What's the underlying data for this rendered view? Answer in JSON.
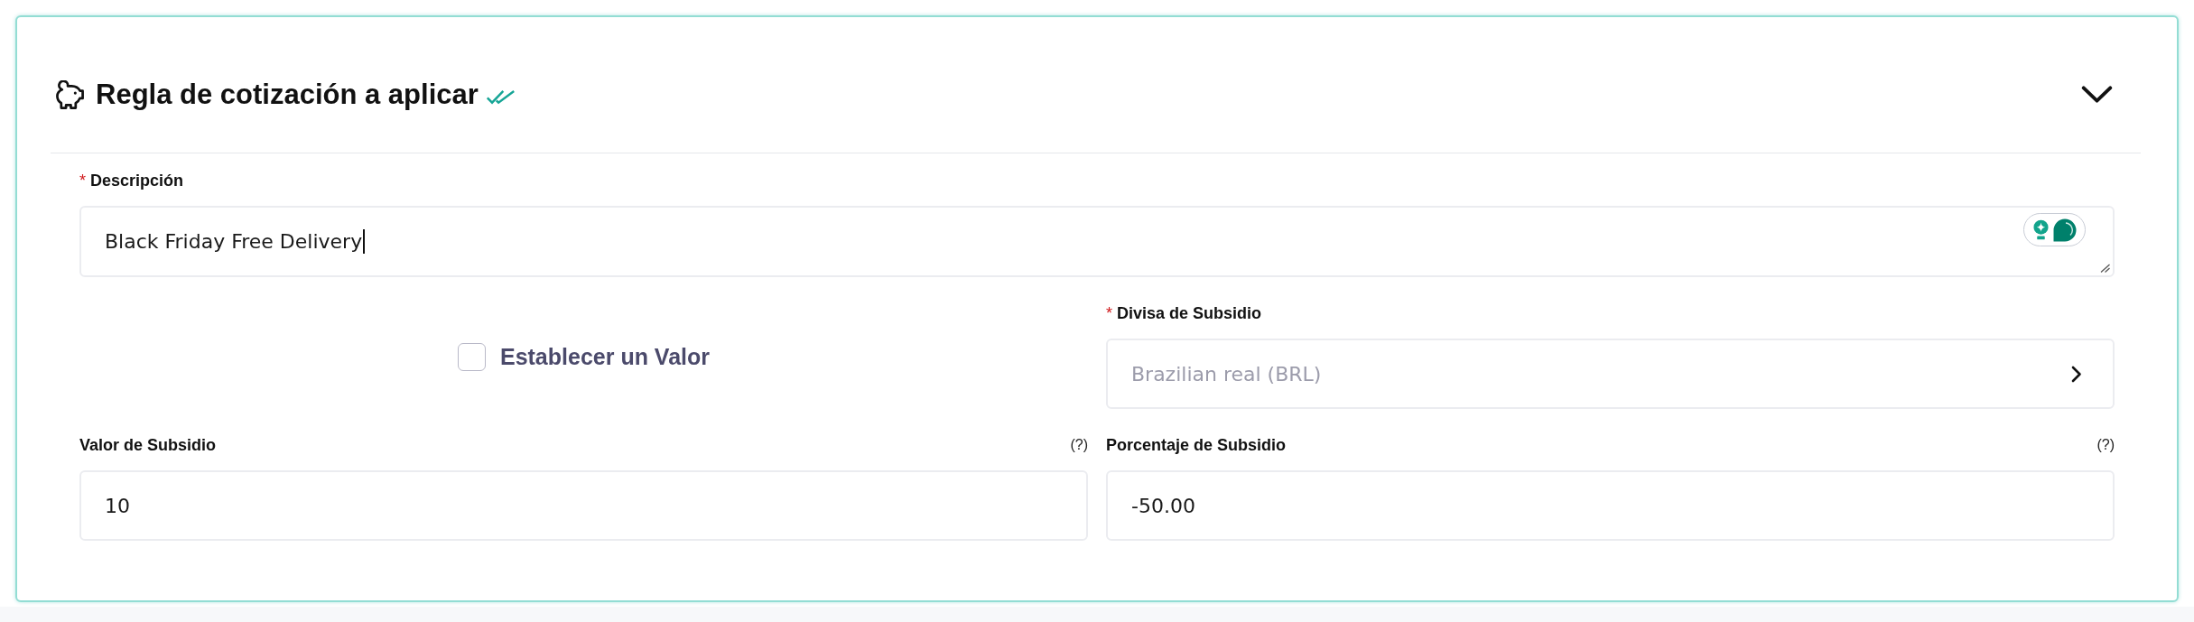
{
  "section": {
    "title": "Regla de cotización a aplicar",
    "verified": true,
    "expanded": true
  },
  "description": {
    "marker": "*",
    "label": "Descripción",
    "value": "Black Friday Free Delivery",
    "focused": true
  },
  "set_value": {
    "label": "Establecer un Valor",
    "checked": false
  },
  "currency": {
    "marker": "*",
    "label": "Divisa de Subsidio",
    "value": "Brazilian real (BRL)",
    "disabled": true
  },
  "amounts": [
    {
      "label": "Valor de Subsidio",
      "help": "(?)",
      "value": "10"
    },
    {
      "label": "Porcentaje de Subsidio",
      "help": "(?)",
      "value": "-50.00"
    }
  ]
}
